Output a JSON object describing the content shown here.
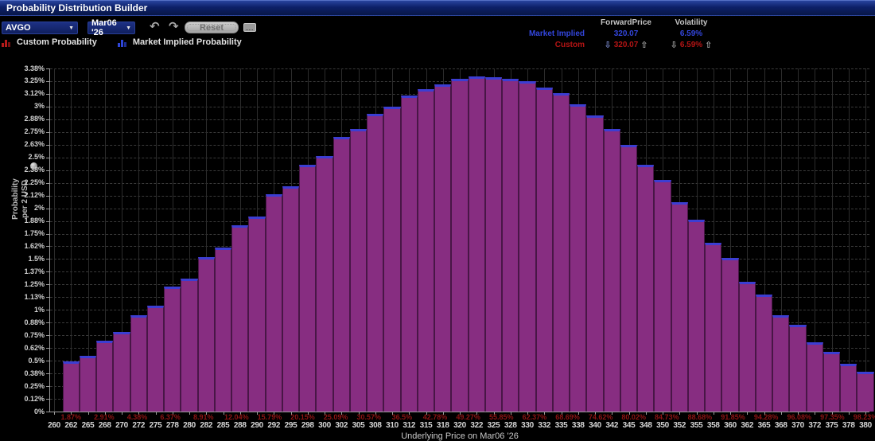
{
  "title_bar": {
    "title": "Probability Distribution Builder"
  },
  "toolbar": {
    "symbol_select": "AVGO",
    "expiry_select": "Mar06 '26",
    "undo_glyph": "↶",
    "redo_glyph": "↷",
    "reset_label": "Reset"
  },
  "legend": {
    "custom_label": "Custom Probability",
    "market_label": "Market Implied Probability"
  },
  "params": {
    "header_forward": "ForwardPrice",
    "header_vol": "Volatility",
    "market_label": "Market Implied",
    "market_forward": "320.07",
    "market_vol": "6.59%",
    "custom_label": "Custom",
    "custom_forward": "320.07",
    "custom_vol": "6.59%",
    "down_glyph": "⇩",
    "up_glyph": "⇧"
  },
  "colors": {
    "bar_fill": "#872d81",
    "bar_cap_blue": "#3c3ed2",
    "accent_blue": "#3346dd",
    "accent_red": "#b51414",
    "cumulative_red": "#8e1414",
    "titlebar_blue": "#0d2068"
  },
  "chart_data": {
    "type": "bar",
    "title": "Probability Distribution Builder",
    "xlabel": "Underlying Price on Mar06 '26",
    "ylabel": "Probability per 2 USD",
    "ylabel_lines": [
      "Probability",
      "per 2 USD"
    ],
    "ylim": [
      0,
      3.375
    ],
    "grid": true,
    "x_tick_labels": [
      "260",
      "262",
      "265",
      "268",
      "270",
      "272",
      "275",
      "278",
      "280",
      "282",
      "285",
      "288",
      "290",
      "292",
      "295",
      "298",
      "300",
      "302",
      "305",
      "308",
      "310",
      "312",
      "315",
      "318",
      "320",
      "322",
      "325",
      "328",
      "330",
      "332",
      "335",
      "338",
      "340",
      "342",
      "345",
      "348",
      "350",
      "352",
      "355",
      "358",
      "360",
      "362",
      "365",
      "368",
      "370",
      "372",
      "375",
      "378",
      "380"
    ],
    "y_tick_labels": [
      "3.38%",
      "3.25%",
      "3.12%",
      "3%",
      "2.88%",
      "2.75%",
      "2.63%",
      "2.5%",
      "2.38%",
      "2.25%",
      "2.12%",
      "2%",
      "1.88%",
      "1.75%",
      "1.62%",
      "1.5%",
      "1.37%",
      "1.25%",
      "1.13%",
      "1%",
      "0.88%",
      "0.75%",
      "0.62%",
      "0.5%",
      "0.38%",
      "0.25%",
      "0.12%",
      "0%"
    ],
    "series": [
      {
        "name": "Market Implied Probability",
        "note": "bars start at x tick 262 and are centered on ticks; Custom Probability series is identical and overlaps (purple fill with blue cap)",
        "first_bar_tick_index": 1,
        "values_pct": [
          0.49,
          0.55,
          0.7,
          0.78,
          0.95,
          1.04,
          1.23,
          1.31,
          1.52,
          1.61,
          1.83,
          1.92,
          2.14,
          2.22,
          2.43,
          2.51,
          2.7,
          2.78,
          2.93,
          3.0,
          3.11,
          3.17,
          3.22,
          3.27,
          3.3,
          3.29,
          3.27,
          3.25,
          3.19,
          3.13,
          3.02,
          2.91,
          2.78,
          2.62,
          2.43,
          2.28,
          2.06,
          1.89,
          1.66,
          1.51,
          1.28,
          1.15,
          0.95,
          0.85,
          0.68,
          0.59,
          0.47,
          0.39
        ]
      }
    ],
    "cumulative_pct_labels": [
      "1.87%",
      "2.91%",
      "4.38%",
      "6.37%",
      "8.91%",
      "12.04%",
      "15.79%",
      "20.15%",
      "25.09%",
      "30.57%",
      "36.5%",
      "42.78%",
      "49.27%",
      "55.85%",
      "62.37%",
      "68.69%",
      "74.62%",
      "80.02%",
      "84.73%",
      "88.68%",
      "91.85%",
      "94.28%",
      "96.08%",
      "97.35%",
      "98.23%"
    ]
  }
}
